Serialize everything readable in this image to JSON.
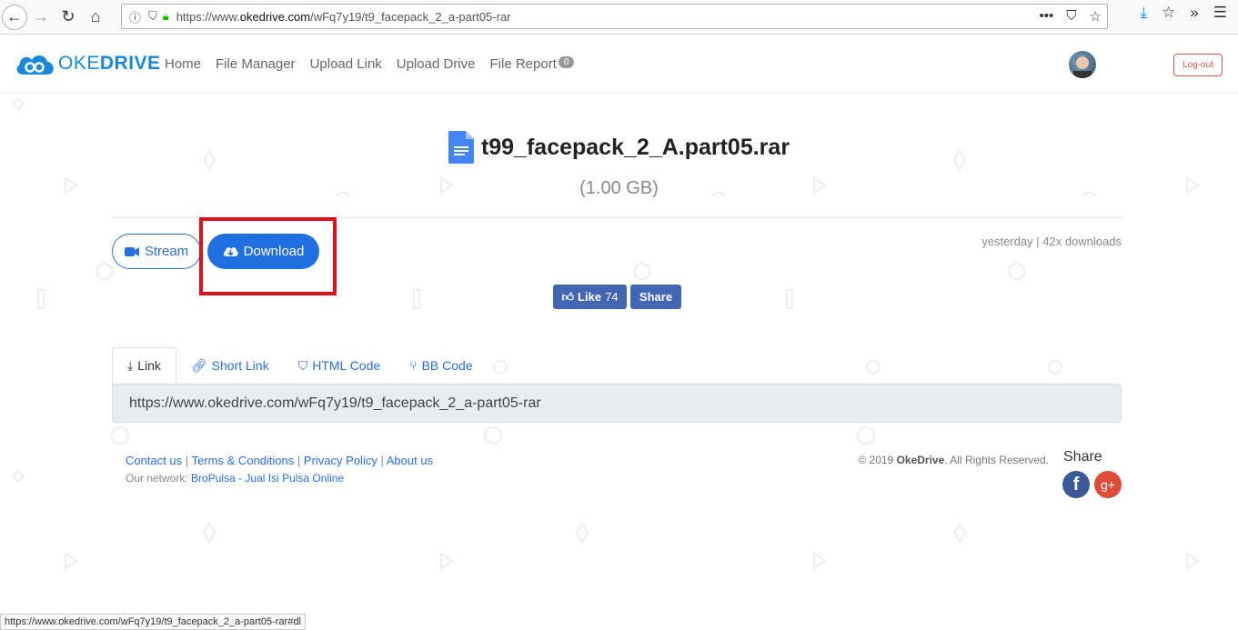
{
  "browser": {
    "url_prefix": "https://www.",
    "url_domain": "okedrive.com",
    "url_path": "/wFq7y19/t9_facepack_2_a-part05-rar",
    "status_url": "https://www.okedrive.com/wFq7y19/t9_facepack_2_a-part05-rar#dl"
  },
  "site": {
    "logo_main": "OKE",
    "logo_bold": "DRIVE",
    "nav": [
      {
        "label": "Home"
      },
      {
        "label": "File Manager"
      },
      {
        "label": "Upload Link"
      },
      {
        "label": "Upload Drive"
      },
      {
        "label": "File Report",
        "badge": "0"
      }
    ],
    "logout": "Log-out"
  },
  "file": {
    "name": "t99_facepack_2_A.part05.rar",
    "size": "(1.00 GB)",
    "meta": "yesterday | 42x downloads"
  },
  "actions": {
    "stream": "Stream",
    "download": "Download"
  },
  "facebook": {
    "like": "Like",
    "like_count": "74",
    "share": "Share"
  },
  "tabs": [
    {
      "label": "Link",
      "active": true
    },
    {
      "label": "Short Link"
    },
    {
      "label": "HTML Code"
    },
    {
      "label": "BB Code"
    }
  ],
  "link_value": "https://www.okedrive.com/wFq7y19/t9_facepack_2_a-part05-rar",
  "footer": {
    "links": [
      "Contact us",
      "Terms & Conditions",
      "Privacy Policy",
      "About us"
    ],
    "network_label": "Our network:",
    "network_link": "BroPulsa - Jual Isi Pulsa Online",
    "copyright_pre": "© 2019",
    "copyright_brand": "OkeDrive",
    "copyright_post": ", All Rights Reserved.",
    "share_label": "Share",
    "fb_glyph": "f",
    "gplus_glyph": "g+"
  },
  "colors": {
    "accent": "#1f6fe0",
    "facebook": "#4267b2",
    "highlight": "#e0101a"
  }
}
